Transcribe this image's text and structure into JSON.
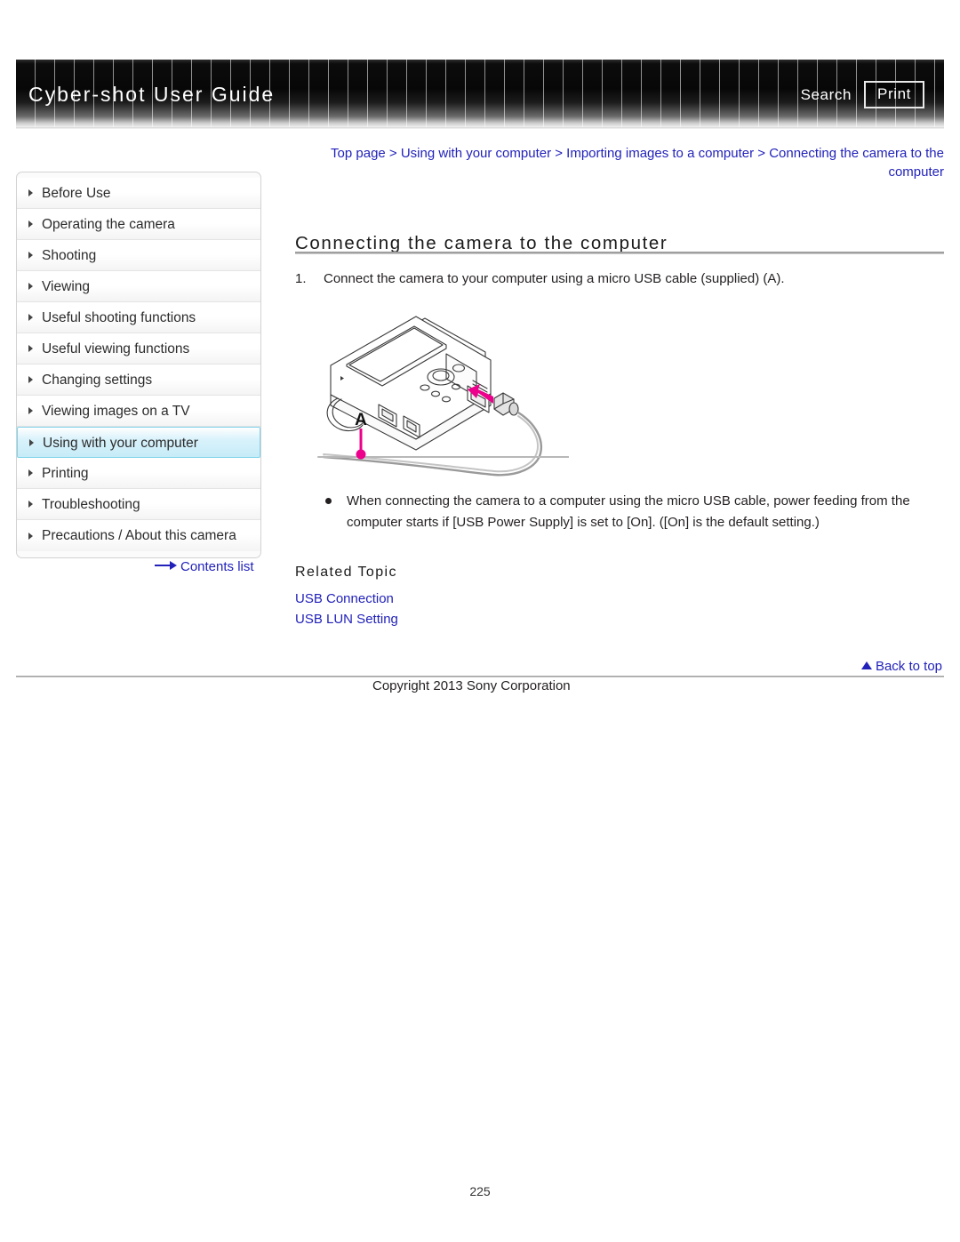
{
  "header": {
    "title": "Cyber-shot User Guide",
    "search_label": "Search",
    "print_label": "Print"
  },
  "sidebar": {
    "items": [
      {
        "label": "Before Use",
        "active": false
      },
      {
        "label": "Operating the camera",
        "active": false
      },
      {
        "label": "Shooting",
        "active": false
      },
      {
        "label": "Viewing",
        "active": false
      },
      {
        "label": "Useful shooting functions",
        "active": false
      },
      {
        "label": "Useful viewing functions",
        "active": false
      },
      {
        "label": "Changing settings",
        "active": false
      },
      {
        "label": "Viewing images on a TV",
        "active": false
      },
      {
        "label": "Using with your computer",
        "active": true
      },
      {
        "label": "Printing",
        "active": false
      },
      {
        "label": "Troubleshooting",
        "active": false
      },
      {
        "label": "Precautions / About this camera",
        "active": false
      }
    ],
    "contents_list_label": "Contents list"
  },
  "main": {
    "breadcrumb": "Top page > Using with your computer > Importing images to a computer > Connecting the camera to the computer",
    "page_title": "Connecting the camera to the computer",
    "step_number": "1.",
    "step_text": "Connect the camera to your computer using a micro USB cable (supplied) (A).",
    "figure_callout": "A",
    "note_text": "When connecting the camera to a computer using the micro USB cable, power feeding from the computer starts if [USB Power Supply] is set to [On]. ([On] is the default setting.)",
    "related_topic_heading": "Related Topic",
    "related_topic_links": [
      "USB Connection",
      "USB LUN Setting"
    ]
  },
  "footer": {
    "back_to_top_label": "Back to top",
    "copyright": "Copyright 2013 Sony Corporation",
    "page_number": "225"
  },
  "colors": {
    "link_blue": "#2222bb",
    "callout_magenta": "#ec008c",
    "active_nav_cyan": "#c6ecf8",
    "header_dark": "#070707"
  }
}
